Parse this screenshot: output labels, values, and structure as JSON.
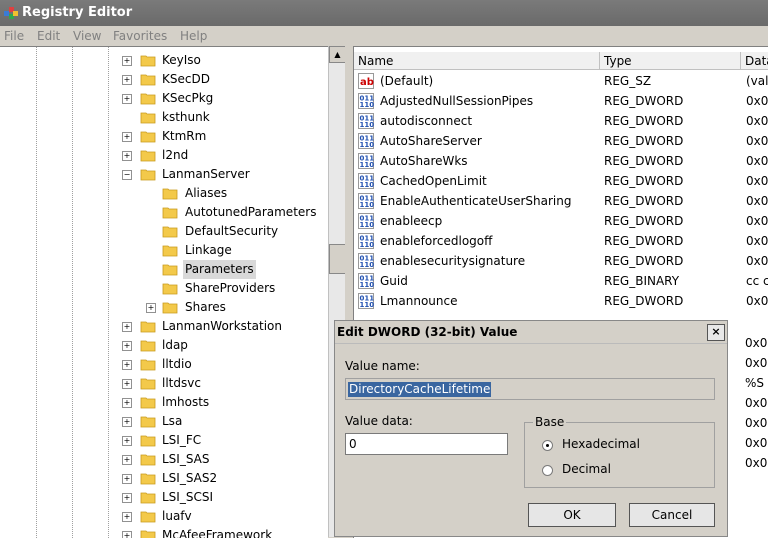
{
  "window": {
    "title": "Registry Editor"
  },
  "menu": [
    "File",
    "Edit",
    "View",
    "Favorites",
    "Help"
  ],
  "tree": {
    "items": [
      {
        "label": "KeyIso",
        "expander": "+",
        "level": 0
      },
      {
        "label": "KSecDD",
        "expander": "+",
        "level": 0
      },
      {
        "label": "KSecPkg",
        "expander": "+",
        "level": 0
      },
      {
        "label": "ksthunk",
        "expander": "",
        "level": 0
      },
      {
        "label": "KtmRm",
        "expander": "+",
        "level": 0
      },
      {
        "label": "l2nd",
        "expander": "+",
        "level": 0
      },
      {
        "label": "LanmanServer",
        "expander": "−",
        "level": 0
      },
      {
        "label": "Aliases",
        "expander": "",
        "level": 1
      },
      {
        "label": "AutotunedParameters",
        "expander": "",
        "level": 1
      },
      {
        "label": "DefaultSecurity",
        "expander": "",
        "level": 1
      },
      {
        "label": "Linkage",
        "expander": "",
        "level": 1
      },
      {
        "label": "Parameters",
        "expander": "",
        "level": 1,
        "selected": true
      },
      {
        "label": "ShareProviders",
        "expander": "",
        "level": 1
      },
      {
        "label": "Shares",
        "expander": "+",
        "level": 1
      },
      {
        "label": "LanmanWorkstation",
        "expander": "+",
        "level": 0
      },
      {
        "label": "ldap",
        "expander": "+",
        "level": 0
      },
      {
        "label": "lltdio",
        "expander": "+",
        "level": 0
      },
      {
        "label": "lltdsvc",
        "expander": "+",
        "level": 0
      },
      {
        "label": "lmhosts",
        "expander": "+",
        "level": 0
      },
      {
        "label": "Lsa",
        "expander": "+",
        "level": 0
      },
      {
        "label": "LSI_FC",
        "expander": "+",
        "level": 0
      },
      {
        "label": "LSI_SAS",
        "expander": "+",
        "level": 0
      },
      {
        "label": "LSI_SAS2",
        "expander": "+",
        "level": 0
      },
      {
        "label": "LSI_SCSI",
        "expander": "+",
        "level": 0
      },
      {
        "label": "luafv",
        "expander": "+",
        "level": 0
      },
      {
        "label": "McAfeeFramework",
        "expander": "+",
        "level": 0
      }
    ]
  },
  "list": {
    "columns": {
      "name": "Name",
      "type": "Type",
      "data": "Data"
    },
    "rows": [
      {
        "name": "(Default)",
        "type": "REG_SZ",
        "data": "(val",
        "icon": "string-value-icon"
      },
      {
        "name": "AdjustedNullSessionPipes",
        "type": "REG_DWORD",
        "data": "0x0",
        "icon": "binary-value-icon"
      },
      {
        "name": "autodisconnect",
        "type": "REG_DWORD",
        "data": "0x0",
        "icon": "binary-value-icon"
      },
      {
        "name": "AutoShareServer",
        "type": "REG_DWORD",
        "data": "0x0",
        "icon": "binary-value-icon"
      },
      {
        "name": "AutoShareWks",
        "type": "REG_DWORD",
        "data": "0x0",
        "icon": "binary-value-icon"
      },
      {
        "name": "CachedOpenLimit",
        "type": "REG_DWORD",
        "data": "0x0",
        "icon": "binary-value-icon"
      },
      {
        "name": "EnableAuthenticateUserSharing",
        "type": "REG_DWORD",
        "data": "0x0",
        "icon": "binary-value-icon"
      },
      {
        "name": "enableecp",
        "type": "REG_DWORD",
        "data": "0x0",
        "icon": "binary-value-icon"
      },
      {
        "name": "enableforcedlogoff",
        "type": "REG_DWORD",
        "data": "0x0",
        "icon": "binary-value-icon"
      },
      {
        "name": "enablesecuritysignature",
        "type": "REG_DWORD",
        "data": "0x0",
        "icon": "binary-value-icon"
      },
      {
        "name": "Guid",
        "type": "REG_BINARY",
        "data": "cc c",
        "icon": "binary-value-icon"
      },
      {
        "name": "Lmannounce",
        "type": "REG_DWORD",
        "data": "0x0",
        "icon": "binary-value-icon"
      }
    ],
    "hidden_data": [
      "0x0",
      "0x0",
      "%S",
      "0x0",
      "0x0",
      "0x0",
      "0x0"
    ]
  },
  "dialog": {
    "title": "Edit DWORD (32-bit) Value",
    "close_label": "×",
    "value_name_label": "Value name:",
    "value_name": "DirectoryCacheLifetime",
    "value_data_label": "Value data:",
    "value_data": "0",
    "base_label": "Base",
    "base_options": [
      {
        "label": "Hexadecimal",
        "selected": true
      },
      {
        "label": "Decimal",
        "selected": false
      }
    ],
    "ok_label": "OK",
    "cancel_label": "Cancel"
  }
}
